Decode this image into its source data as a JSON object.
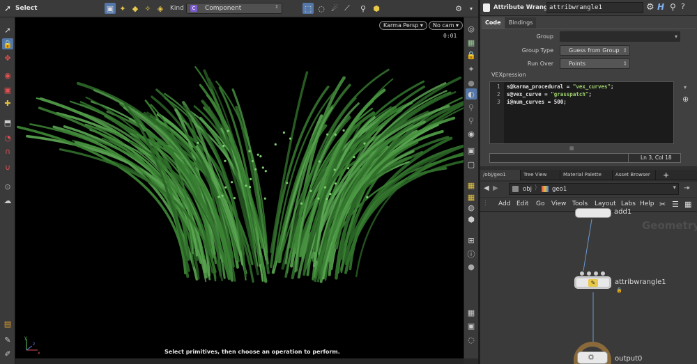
{
  "toolbar": {
    "select_label": "Select",
    "kind_label": "Kind",
    "kind_value": "Component",
    "kind_badge": "C"
  },
  "viewport": {
    "camera_label": "Karma Persp",
    "cam_label": "No cam",
    "time_label": "0:01",
    "status_text": "Select primitives, then choose an operation to perform.",
    "axis_x": "x",
    "axis_y": "y",
    "axis_z": "z"
  },
  "params": {
    "node_type": "Attribute Wrangle",
    "node_name": "attribwrangle1",
    "tabs": [
      "Code",
      "Bindings"
    ],
    "group_label": "Group",
    "group_value": "",
    "group_type_label": "Group Type",
    "group_type_value": "Guess from Group",
    "run_over_label": "Run Over",
    "run_over_value": "Points",
    "vex_label": "VEXpression",
    "code_lines": [
      {
        "num": "1",
        "pre": "s@karma_procedural = ",
        "str": "\"vex_curves\"",
        "post": ";"
      },
      {
        "num": "2",
        "pre": "s@vex_curve = ",
        "str": "\"grasspatch\"",
        "post": ";"
      },
      {
        "num": "3",
        "pre": "i@num_curves = 500;",
        "str": "",
        "post": ""
      }
    ],
    "cursor_status": "Ln 3, Col 18"
  },
  "network": {
    "tabs": [
      "/obj/geo1",
      "Tree View",
      "Material Palette",
      "Asset Browser"
    ],
    "plus": "+",
    "path_obj": "obj",
    "path_geo": "geo1",
    "menus": [
      "Add",
      "Edit",
      "Go",
      "View",
      "Tools",
      "Layout",
      "Labs",
      "Help"
    ],
    "watermark": "Geometry",
    "nodes": {
      "add": "add1",
      "wrangle": "attribwrangle1",
      "output": "output0"
    }
  },
  "colors": {
    "select_blue": "#5577a8",
    "grass_green": "#3f8a38",
    "viewport_bg": "#000000"
  }
}
